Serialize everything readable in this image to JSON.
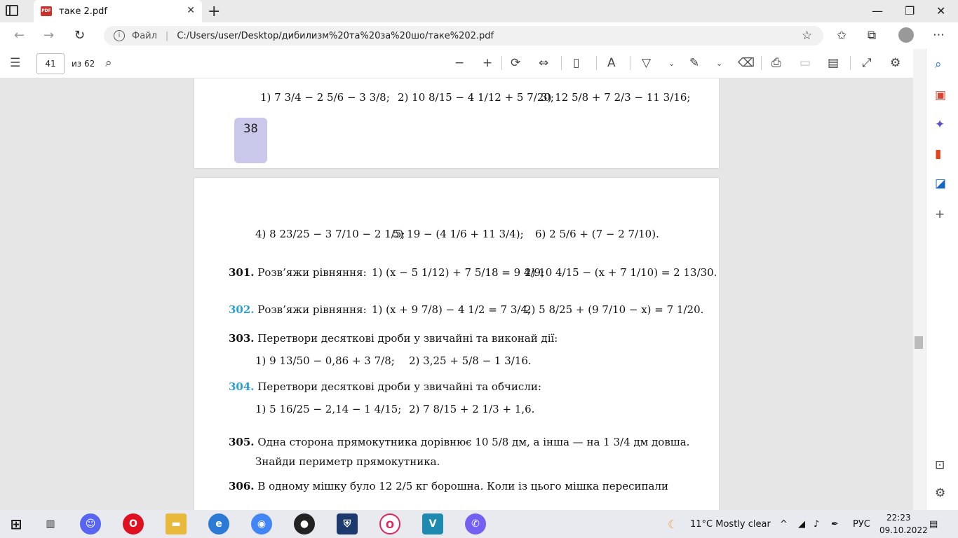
{
  "browser": {
    "tab_title": "таке 2.pdf",
    "tab_close": "✕",
    "new_tab": "+",
    "url_scheme": "Файл",
    "url": "C:/Users/user/Desktop/дибилизм%20та%20за%20шо/таке%202.pdf",
    "window_min": "—",
    "window_max": "❐",
    "window_close": "✕"
  },
  "pdf_toolbar": {
    "page_current": "41",
    "page_total": "из 62"
  },
  "page_top": {
    "problems": [
      "1) 7 3/4 − 2 5/6 − 3 3/8;",
      "2) 10 8/15 − 4 1/12 + 5 7/20;",
      "3) 12 5/8 + 7 2/3 − 11 3/16;"
    ],
    "page_number": "38"
  },
  "page_bottom": {
    "row_a": [
      "4) 8 23/25 − 3 7/10 − 2 1/5;",
      "5) 19 − (4 1/6 + 11 3/4);",
      "6) 2 5/6 + (7 − 2 7/10)."
    ],
    "p301_num": "301.",
    "p301_text": "Розв’яжи рівняння:",
    "p301_1": "1) (x − 5 1/12) + 7 5/18 = 9 4/9;",
    "p301_2": "2) 10 4/15 − (x + 7 1/10) = 2 13/30.",
    "p302_num": "302.",
    "p302_text": "Розв’яжи рівняння:",
    "p302_1": "1) (x + 9 7/8) − 4 1/2 = 7 3/4;",
    "p302_2": "2) 5 8/25 + (9 7/10 − x) = 7 1/20.",
    "p303_num": "303.",
    "p303_text": "Перетвори десяткові дроби у звичайні та виконай дії:",
    "p303_1": "1) 9 13/50 − 0,86 + 3 7/8;",
    "p303_2": "2) 3,25 + 5/8 − 1 3/16.",
    "p304_num": "304.",
    "p304_text": "Перетвори десяткові дроби у звичайні та обчисли:",
    "p304_1": "1) 5 16/25 − 2,14 − 1 4/15;",
    "p304_2": "2) 7 8/15 + 2 1/3 + 1,6.",
    "p305_num": "305.",
    "p305_text": "Одна сторона прямокутника дорівнює 10 5/8 дм, а інша — на 1 3/4 дм довша.",
    "p305_text2": "Знайди периметр прямокутника.",
    "p306_num": "306.",
    "p306_text": "В одному мішку було 12 2/5 кг борошна. Коли із цього мішка пересипали"
  },
  "taskbar": {
    "weather": "11°C  Mostly clear",
    "lang": "РУС",
    "time": "22:23",
    "date": "09.10.2022"
  }
}
